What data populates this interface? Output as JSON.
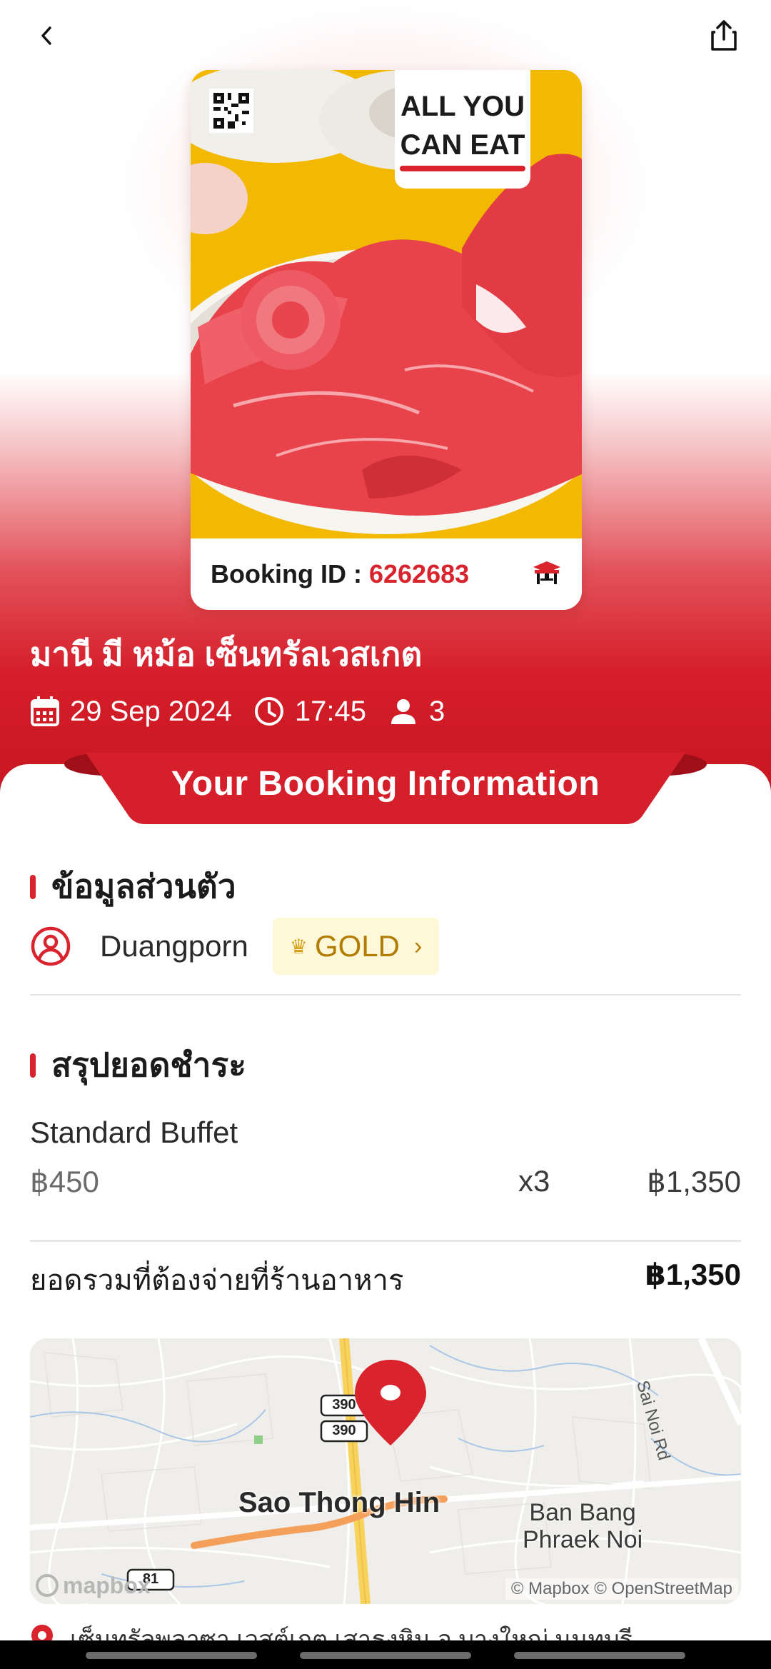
{
  "topbar": {
    "back_icon": "chevron-left-icon",
    "share_icon": "share-icon"
  },
  "card": {
    "tag_line1": "ALL YOU",
    "tag_line2": "CAN EAT",
    "booking_label": "Booking ID :",
    "booking_id": "6262683",
    "table_icon": "table-icon",
    "qr_icon": "qr-code-icon"
  },
  "restaurant": {
    "name": "มานี มี หม้อ เซ็นทรัลเวสเกต",
    "date": "29 Sep 2024",
    "time": "17:45",
    "guests": "3"
  },
  "banner": {
    "title": "Your Booking Information"
  },
  "personal": {
    "section_title": "ข้อมูลส่วนตัว",
    "user_name": "Duangporn",
    "tier": "GOLD",
    "chevron": "›"
  },
  "payment": {
    "section_title": "สรุปยอดชำระ",
    "item_name": "Standard Buffet",
    "unit_price": "฿450",
    "quantity": "x3",
    "line_total": "฿1,350",
    "grand_label": "ยอดรวมที่ต้องจ่ายที่ร้านอาหาร",
    "grand_total": "฿1,350"
  },
  "map": {
    "place_label": "Sao Thong Hin",
    "place_label2_line1": "Ban Bang",
    "place_label2_line2": "Phraek Noi",
    "road_label": "Sai Noi Rd",
    "shield1": "390",
    "shield2": "390",
    "shield3": "81",
    "brand": "mapbox",
    "attribution": "© Mapbox © OpenStreetMap"
  },
  "address": {
    "text": "เซ็นทรัลพลาซา เวสต์เกต เสาธงหิน อ.บางใหญ่ นนทบุรี"
  },
  "colors": {
    "brand_red": "#d9232d",
    "gold_bg": "#fff8d8",
    "gold_text": "#b17c00"
  }
}
